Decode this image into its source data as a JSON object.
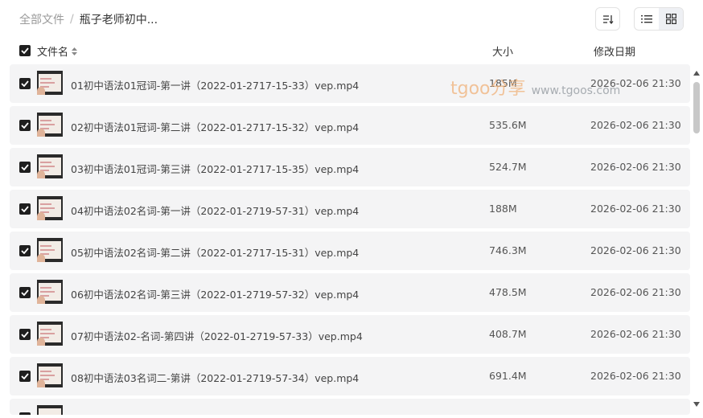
{
  "breadcrumb": {
    "root": "全部文件",
    "separator": "/",
    "current": "瓶子老师初中..."
  },
  "toolbar": {
    "sort_icon": "sort-icon",
    "list_view_icon": "list-view-icon",
    "grid_view_icon": "grid-view-icon",
    "active_view": "list"
  },
  "columns": {
    "name": "文件名",
    "size": "大小",
    "date": "修改日期"
  },
  "files": [
    {
      "name": "01初中语法01冠词-第一讲（2022-01-2717-15-33）vep.mp4",
      "size": "185M",
      "date": "2026-02-06 21:30",
      "checked": true
    },
    {
      "name": "02初中语法01冠词-第二讲（2022-01-2717-15-32）vep.mp4",
      "size": "535.6M",
      "date": "2026-02-06 21:30",
      "checked": true
    },
    {
      "name": "03初中语法01冠词-第三讲（2022-01-2717-15-35）vep.mp4",
      "size": "524.7M",
      "date": "2026-02-06 21:30",
      "checked": true
    },
    {
      "name": "04初中语法02名词-第一讲（2022-01-2719-57-31）vep.mp4",
      "size": "188M",
      "date": "2026-02-06 21:30",
      "checked": true
    },
    {
      "name": "05初中语法02名词-第二讲（2022-01-2717-15-31）vep.mp4",
      "size": "746.3M",
      "date": "2026-02-06 21:30",
      "checked": true
    },
    {
      "name": "06初中语法02名词-第三讲（2022-01-2719-57-32）vep.mp4",
      "size": "478.5M",
      "date": "2026-02-06 21:30",
      "checked": true
    },
    {
      "name": "07初中语法02-名词-第四讲（2022-01-2719-57-33）vep.mp4",
      "size": "408.7M",
      "date": "2026-02-06 21:30",
      "checked": true
    },
    {
      "name": "08初中语法03名词二-第讲（2022-01-2719-57-34）vep.mp4",
      "size": "691.4M",
      "date": "2026-02-06 21:30",
      "checked": true
    }
  ],
  "watermark": {
    "main": "tgoo分享",
    "sub": "www.tgoos.com"
  },
  "colors": {
    "row_bg": "#f4f4f5",
    "checkbox": "#1f1f1f",
    "watermark": "#f0b27a"
  }
}
